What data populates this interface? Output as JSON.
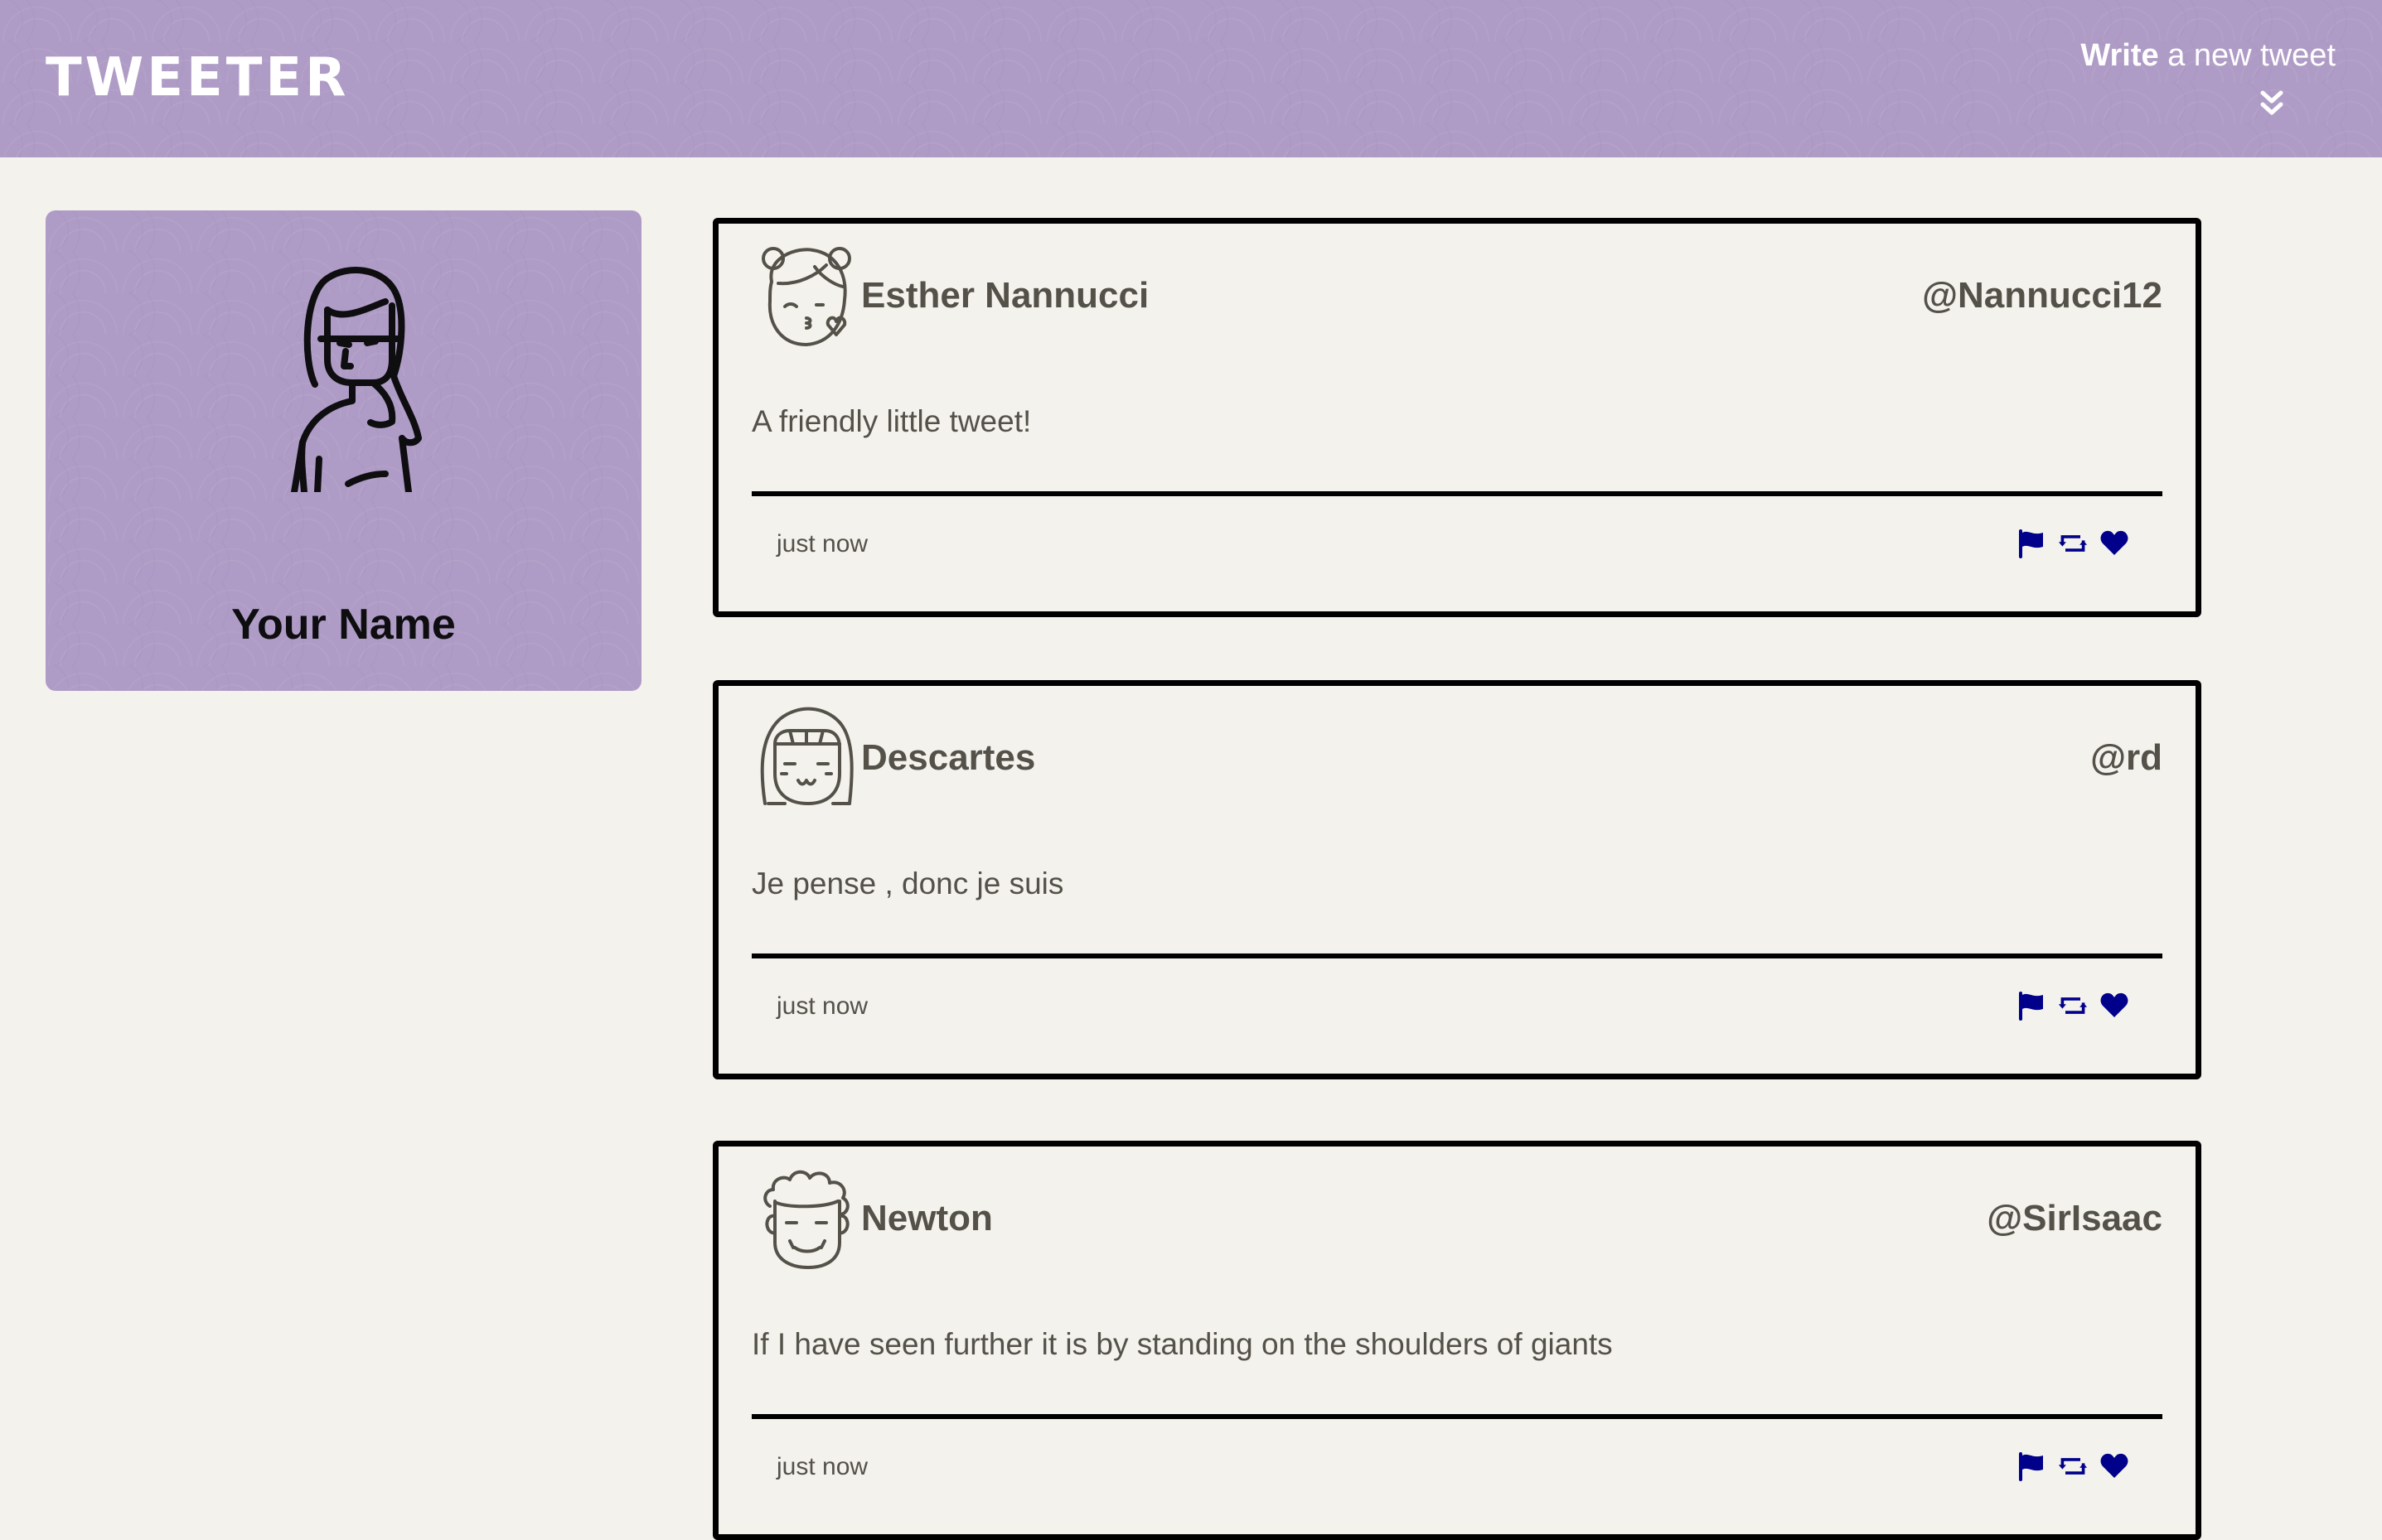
{
  "nav": {
    "brand": "TWEETER",
    "compose_bold": "Write",
    "compose_rest": " a new tweet",
    "compose_icon": "double-chevron-down-icon"
  },
  "profile": {
    "name": "Your Name",
    "avatar_icon": "user-avatar-icon"
  },
  "colors": {
    "header_bg": "#af9cc6",
    "page_bg": "#f4f2ed",
    "text": "#545149",
    "action_icons": "#00008b"
  },
  "tweets": [
    {
      "name": "Esther Nannucci",
      "handle": "@Nannucci12",
      "text": "A friendly little tweet!",
      "time": "just now",
      "avatar_icon": "girl-kiss-avatar-icon"
    },
    {
      "name": "Descartes",
      "handle": "@rd",
      "text": "Je pense , donc je suis",
      "time": "just now",
      "avatar_icon": "bangs-smile-avatar-icon"
    },
    {
      "name": "Newton",
      "handle": "@SirIsaac",
      "text": "If I have seen further it is by standing on the shoulders of giants",
      "time": "just now",
      "avatar_icon": "curly-hair-avatar-icon"
    }
  ],
  "actions": [
    "flag-icon",
    "retweet-icon",
    "heart-icon"
  ]
}
